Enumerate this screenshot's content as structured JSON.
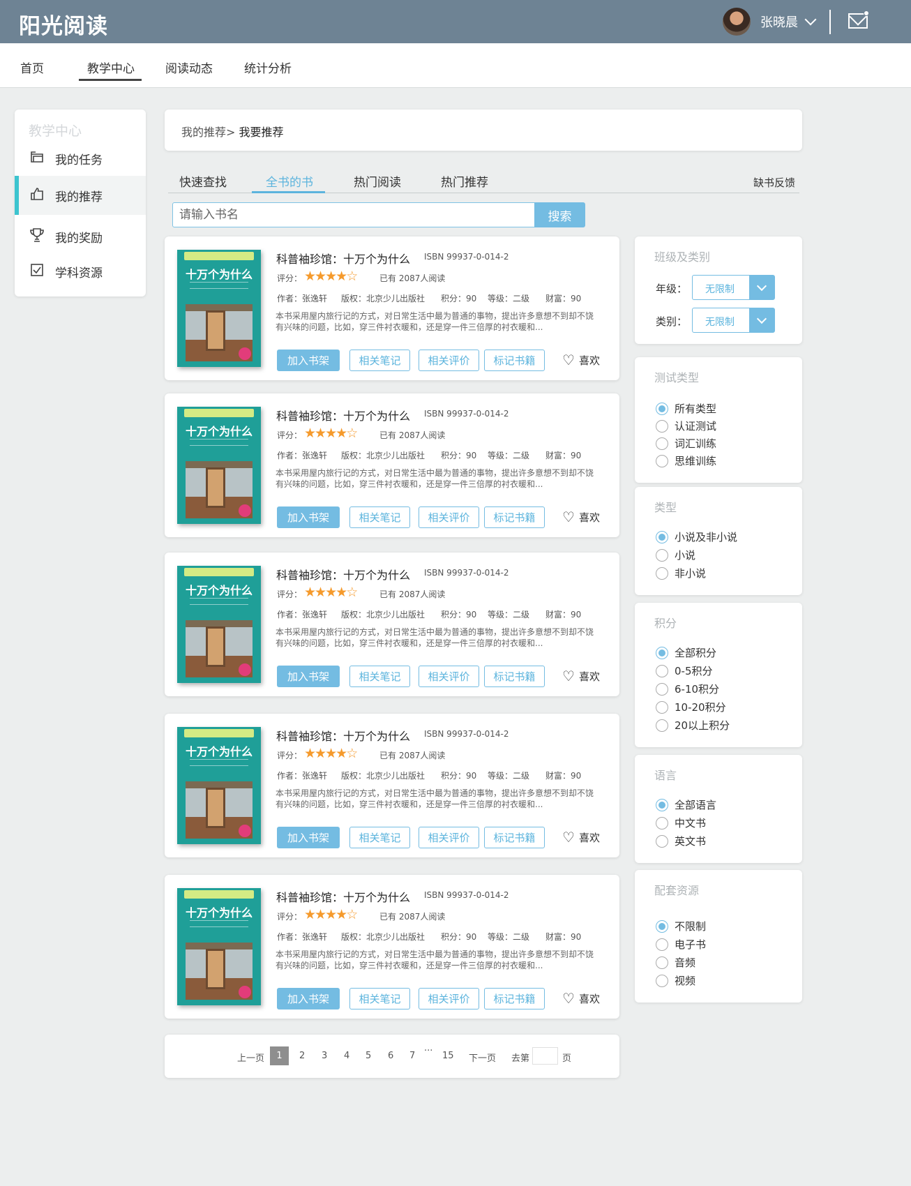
{
  "header": {
    "logo": "阳光阅读",
    "user_name": "张晓晨"
  },
  "nav": {
    "items": [
      "首页",
      "教学中心",
      "阅读动态",
      "统计分析"
    ],
    "active": "教学中心"
  },
  "sidebar": {
    "title": "教学中心",
    "items": [
      {
        "label": "我的任务",
        "icon": "task-icon"
      },
      {
        "label": "我的推荐",
        "icon": "thumbs-up-icon",
        "active": true
      },
      {
        "label": "我的奖励",
        "icon": "trophy-icon"
      },
      {
        "label": "学科资源",
        "icon": "checkbox-icon"
      }
    ]
  },
  "breadcrumb": {
    "parent": "我的推荐>",
    "current": "我要推荐"
  },
  "tabs": {
    "items": [
      "快速查找",
      "全书的书",
      "热门阅读",
      "热门推荐"
    ],
    "active": "全书的书",
    "feedback": "缺书反馈"
  },
  "search": {
    "placeholder": "请输入书名",
    "button": "搜索"
  },
  "books": [
    {
      "cover_title": "十万个为什么",
      "title": "科普袖珍馆：十万个为什么",
      "isbn": "ISBN 99937-0-014-2",
      "rating_label": "评分：",
      "rating": 4,
      "readers": "已有 2087人阅读",
      "author": "作者：张逸轩",
      "publisher": "版权：北京少儿出版社",
      "points": "积分：90",
      "level": "等级：二级",
      "wealth": "财富：90",
      "desc_line1": "本书采用屋内旅行记的方式，对日常生活中最为普通的事物，提出许多意想不到却不饶",
      "desc_line2": "有兴味的问题，比如，穿三件衬衣暖和，还是穿一件三倍厚的衬衣暖和...",
      "btn_add": "加入书架",
      "btn_notes": "相关笔记",
      "btn_reviews": "相关评价",
      "btn_mark": "标记书籍",
      "like": "喜欢"
    },
    {
      "cover_title": "十万个为什么",
      "title": "科普袖珍馆：十万个为什么",
      "isbn": "ISBN 99937-0-014-2",
      "rating_label": "评分：",
      "rating": 4,
      "readers": "已有 2087人阅读",
      "author": "作者：张逸轩",
      "publisher": "版权：北京少儿出版社",
      "points": "积分：90",
      "level": "等级：二级",
      "wealth": "财富：90",
      "desc_line1": "本书采用屋内旅行记的方式，对日常生活中最为普通的事物，提出许多意想不到却不饶",
      "desc_line2": "有兴味的问题，比如，穿三件衬衣暖和，还是穿一件三倍厚的衬衣暖和...",
      "btn_add": "加入书架",
      "btn_notes": "相关笔记",
      "btn_reviews": "相关评价",
      "btn_mark": "标记书籍",
      "like": "喜欢"
    },
    {
      "cover_title": "十万个为什么",
      "title": "科普袖珍馆：十万个为什么",
      "isbn": "ISBN 99937-0-014-2",
      "rating_label": "评分：",
      "rating": 4,
      "readers": "已有 2087人阅读",
      "author": "作者：张逸轩",
      "publisher": "版权：北京少儿出版社",
      "points": "积分：90",
      "level": "等级：二级",
      "wealth": "财富：90",
      "desc_line1": "本书采用屋内旅行记的方式，对日常生活中最为普通的事物，提出许多意想不到却不饶",
      "desc_line2": "有兴味的问题，比如，穿三件衬衣暖和，还是穿一件三倍厚的衬衣暖和...",
      "btn_add": "加入书架",
      "btn_notes": "相关笔记",
      "btn_reviews": "相关评价",
      "btn_mark": "标记书籍",
      "like": "喜欢"
    },
    {
      "cover_title": "十万个为什么",
      "title": "科普袖珍馆：十万个为什么",
      "isbn": "ISBN 99937-0-014-2",
      "rating_label": "评分：",
      "rating": 4,
      "readers": "已有 2087人阅读",
      "author": "作者：张逸轩",
      "publisher": "版权：北京少儿出版社",
      "points": "积分：90",
      "level": "等级：二级",
      "wealth": "财富：90",
      "desc_line1": "本书采用屋内旅行记的方式，对日常生活中最为普通的事物，提出许多意想不到却不饶",
      "desc_line2": "有兴味的问题，比如，穿三件衬衣暖和，还是穿一件三倍厚的衬衣暖和...",
      "btn_add": "加入书架",
      "btn_notes": "相关笔记",
      "btn_reviews": "相关评价",
      "btn_mark": "标记书籍",
      "like": "喜欢"
    },
    {
      "cover_title": "十万个为什么",
      "title": "科普袖珍馆：十万个为什么",
      "isbn": "ISBN 99937-0-014-2",
      "rating_label": "评分：",
      "rating": 4,
      "readers": "已有 2087人阅读",
      "author": "作者：张逸轩",
      "publisher": "版权：北京少儿出版社",
      "points": "积分：90",
      "level": "等级：二级",
      "wealth": "财富：90",
      "desc_line1": "本书采用屋内旅行记的方式，对日常生活中最为普通的事物，提出许多意想不到却不饶",
      "desc_line2": "有兴味的问题，比如，穿三件衬衣暖和，还是穿一件三倍厚的衬衣暖和...",
      "btn_add": "加入书架",
      "btn_notes": "相关笔记",
      "btn_reviews": "相关评价",
      "btn_mark": "标记书籍",
      "like": "喜欢"
    }
  ],
  "pagination": {
    "prev": "上一页",
    "current": "1",
    "pages": [
      "2",
      "3",
      "4",
      "5",
      "6",
      "7"
    ],
    "ellipsis": "···",
    "last": "15",
    "next": "下一页",
    "goto": "去第",
    "page_unit": "页"
  },
  "filters": {
    "class_category": {
      "title": "班级及类别",
      "grade_label": "年级：",
      "grade_value": "无限制",
      "category_label": "类别：",
      "category_value": "无限制"
    },
    "test_type": {
      "title": "测试类型",
      "options": [
        "所有类型",
        "认证测试",
        "词汇训练",
        "思维训练"
      ],
      "selected": 0
    },
    "genre": {
      "title": "类型",
      "options": [
        "小说及非小说",
        "小说",
        "非小说"
      ],
      "selected": 0
    },
    "points": {
      "title": "积分",
      "options": [
        "全部积分",
        "0-5积分",
        "6-10积分",
        "10-20积分",
        "20以上积分"
      ],
      "selected": 0
    },
    "language": {
      "title": "语言",
      "options": [
        "全部语言",
        "中文书",
        "英文书"
      ],
      "selected": 0
    },
    "resources": {
      "title": "配套资源",
      "options": [
        "不限制",
        "电子书",
        "音频",
        "视频"
      ],
      "selected": 0
    }
  },
  "colors": {
    "header_bg": "#6e8394",
    "accent": "#74bce2",
    "star": "#f59a2c",
    "sidebar_active": "#3cc4cf"
  }
}
